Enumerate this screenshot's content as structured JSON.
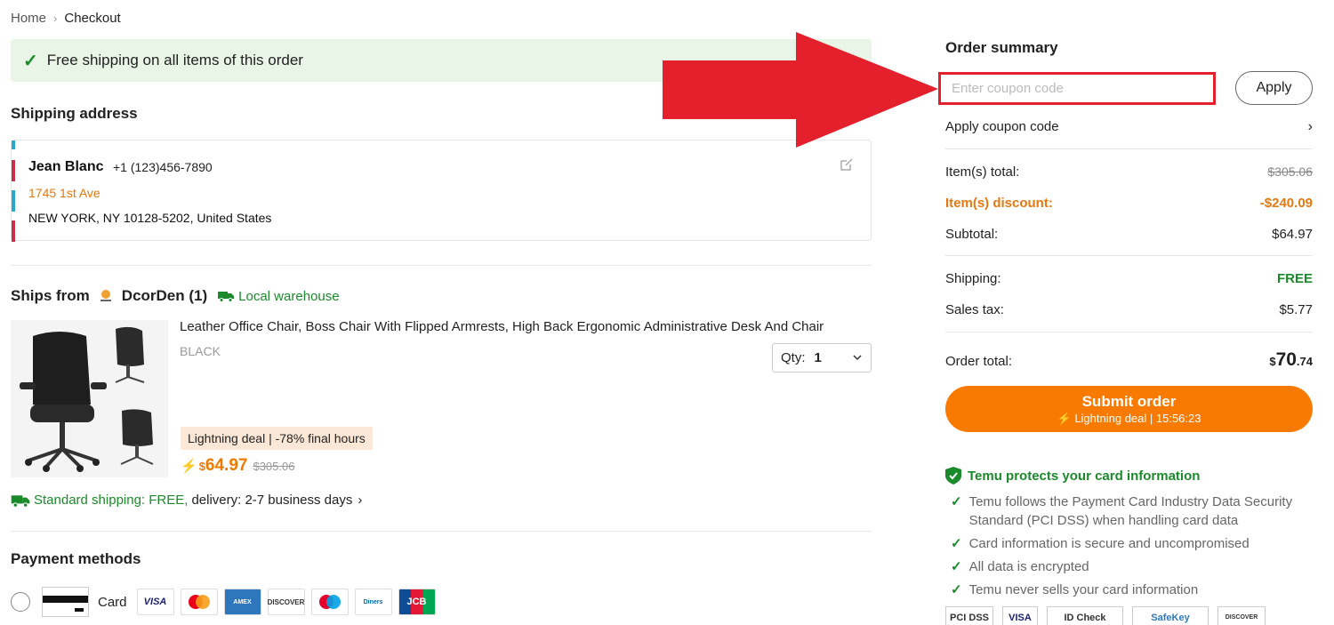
{
  "breadcrumb": {
    "home": "Home",
    "sep": "›",
    "current": "Checkout"
  },
  "banner": {
    "text": "Free shipping on all items of this order"
  },
  "shipping_address": {
    "title": "Shipping address",
    "name": "Jean Blanc",
    "phone": "+1 (123)456-7890",
    "line1": "1745 1st Ave",
    "line2": "NEW YORK, NY 10128-5202, United States"
  },
  "ships_from": {
    "label": "Ships from",
    "store": "DcorDen (1)",
    "warehouse": "Local warehouse"
  },
  "product": {
    "title": "Leather Office Chair, Boss Chair With Flipped Armrests, High Back Ergonomic Administrative Desk And Chair",
    "variant": "BLACK",
    "qty_label": "Qty:",
    "qty_value": "1",
    "deal": "Lightning deal | -78% final hours",
    "currency": "$",
    "price": "64.97",
    "old_price": "$305.06"
  },
  "shipping_info": {
    "free": "Standard shipping: FREE,",
    "delivery": "delivery: 2-7 business days",
    "arrow": "›"
  },
  "payment": {
    "title": "Payment methods",
    "card_label": "Card",
    "brands": [
      "VISA",
      "MC",
      "AMEX",
      "DISCOVER",
      "Maestro",
      "Diners",
      "JCB"
    ]
  },
  "summary": {
    "title": "Order summary",
    "coupon_placeholder": "Enter coupon code",
    "apply": "Apply",
    "apply_coupon": "Apply coupon code",
    "apply_coupon_arrow": "›",
    "items_total_label": "Item(s) total:",
    "items_total": "$305.06",
    "discount_label": "Item(s) discount:",
    "discount": "-$240.09",
    "subtotal_label": "Subtotal:",
    "subtotal": "$64.97",
    "shipping_label": "Shipping:",
    "shipping": "FREE",
    "tax_label": "Sales tax:",
    "tax": "$5.77",
    "order_total_label": "Order total:",
    "order_total_cur": "$",
    "order_total_int": "70",
    "order_total_dec": ".74",
    "submit": "Submit order",
    "submit_sub": "⚡ Lightning deal | 15:56:23"
  },
  "protection": {
    "title": "Temu protects your card information",
    "items": [
      "Temu follows the Payment Card Industry Data Security Standard (PCI DSS) when handling card data",
      "Card information is secure and uncompromised",
      "All data is encrypted",
      "Temu never sells your card information"
    ],
    "badges": [
      "PCI DSS",
      "VISA",
      "ID Check",
      "SafeKey",
      "DISCOVER"
    ]
  },
  "colors": {
    "accent": "#f87a00",
    "green": "#1a8a2a",
    "arrow": "#e3202b"
  }
}
